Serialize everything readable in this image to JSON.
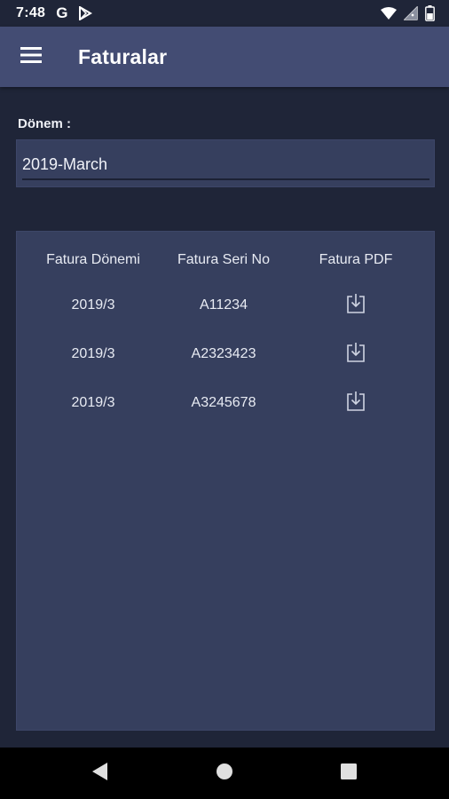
{
  "status_bar": {
    "time": "7:48",
    "g_letter": "G",
    "left_icons": [
      "google-icon",
      "play-store-icon"
    ],
    "right_icons": [
      "wifi-icon",
      "signal-icon",
      "battery-icon"
    ]
  },
  "app_bar": {
    "menu_icon": "hamburger-menu-icon",
    "title": "Faturalar"
  },
  "period": {
    "label": "Dönem :",
    "value": "2019-March"
  },
  "invoice_table": {
    "columns": [
      "Fatura Dönemi",
      "Fatura Seri No",
      "Fatura PDF"
    ],
    "rows": [
      {
        "period": "2019/3",
        "serial": "A11234",
        "pdf_icon": "download-icon"
      },
      {
        "period": "2019/3",
        "serial": "A2323423",
        "pdf_icon": "download-icon"
      },
      {
        "period": "2019/3",
        "serial": "A3245678",
        "pdf_icon": "download-icon"
      }
    ]
  },
  "nav_bar": {
    "icons": [
      "back-icon",
      "home-icon",
      "recents-icon"
    ]
  },
  "colors": {
    "background": "#1f2538",
    "app_bar": "#434c73",
    "panel": "#363f5e",
    "text": "#e8ebf3"
  }
}
